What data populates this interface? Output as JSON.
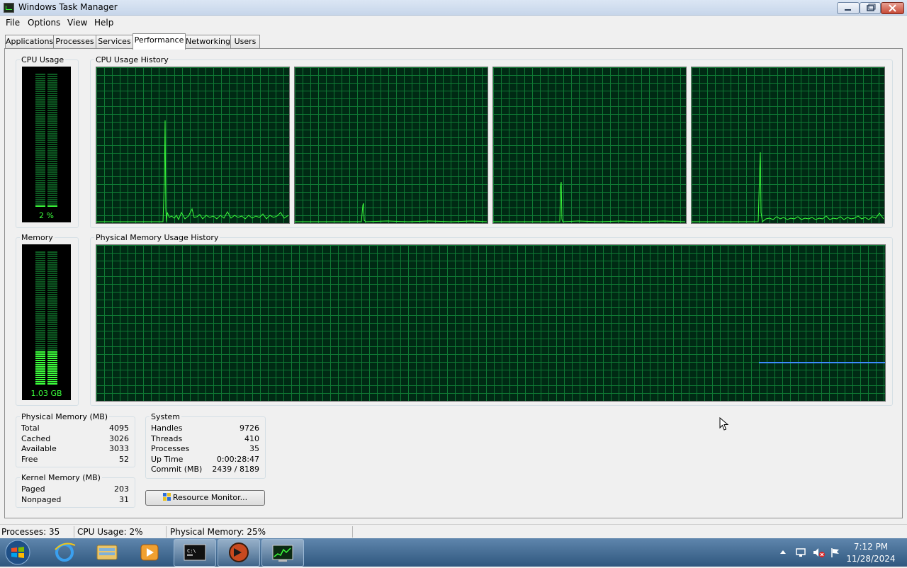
{
  "window": {
    "title": "Windows Task Manager"
  },
  "menu": [
    "File",
    "Options",
    "View",
    "Help"
  ],
  "tabs": [
    "Applications",
    "Processes",
    "Services",
    "Performance",
    "Networking",
    "Users"
  ],
  "active_tab": "Performance",
  "cpu": {
    "group_title": "CPU Usage",
    "value_label": "2 %",
    "history_title": "CPU Usage History",
    "usage_fraction": 0.02
  },
  "memory": {
    "group_title": "Memory",
    "value_label": "1.03 GB",
    "history_title": "Physical Memory Usage History",
    "usage_fraction": 0.25
  },
  "physical_memory": {
    "title": "Physical Memory (MB)",
    "rows": [
      {
        "label": "Total",
        "value": "4095"
      },
      {
        "label": "Cached",
        "value": "3026"
      },
      {
        "label": "Available",
        "value": "3033"
      },
      {
        "label": "Free",
        "value": "52"
      }
    ]
  },
  "kernel_memory": {
    "title": "Kernel Memory (MB)",
    "rows": [
      {
        "label": "Paged",
        "value": "203"
      },
      {
        "label": "Nonpaged",
        "value": "31"
      }
    ]
  },
  "system": {
    "title": "System",
    "rows": [
      {
        "label": "Handles",
        "value": "9726"
      },
      {
        "label": "Threads",
        "value": "410"
      },
      {
        "label": "Processes",
        "value": "35"
      },
      {
        "label": "Up Time",
        "value": "0:00:28:47"
      },
      {
        "label": "Commit (MB)",
        "value": "2439 / 8189"
      }
    ]
  },
  "resource_monitor_label": "Resource Monitor...",
  "status": {
    "processes": "Processes: 35",
    "cpu": "CPU Usage: 2%",
    "memory": "Physical Memory: 25%"
  },
  "taskbar": {
    "start": "windows-start-orb",
    "pinned": [
      "internet-explorer-icon",
      "windows-explorer-icon",
      "media-player-icon",
      "command-prompt-icon",
      "app-icon",
      "task-manager-icon"
    ],
    "clock_time": "7:12 PM",
    "clock_date": "11/28/2024"
  },
  "colors": {
    "graph_bg": "#002a14",
    "grid": "#0f7a34",
    "trace": "#3cff3c",
    "memory_trace": "#3d8bff",
    "taskbar": "#3f6a94"
  }
}
